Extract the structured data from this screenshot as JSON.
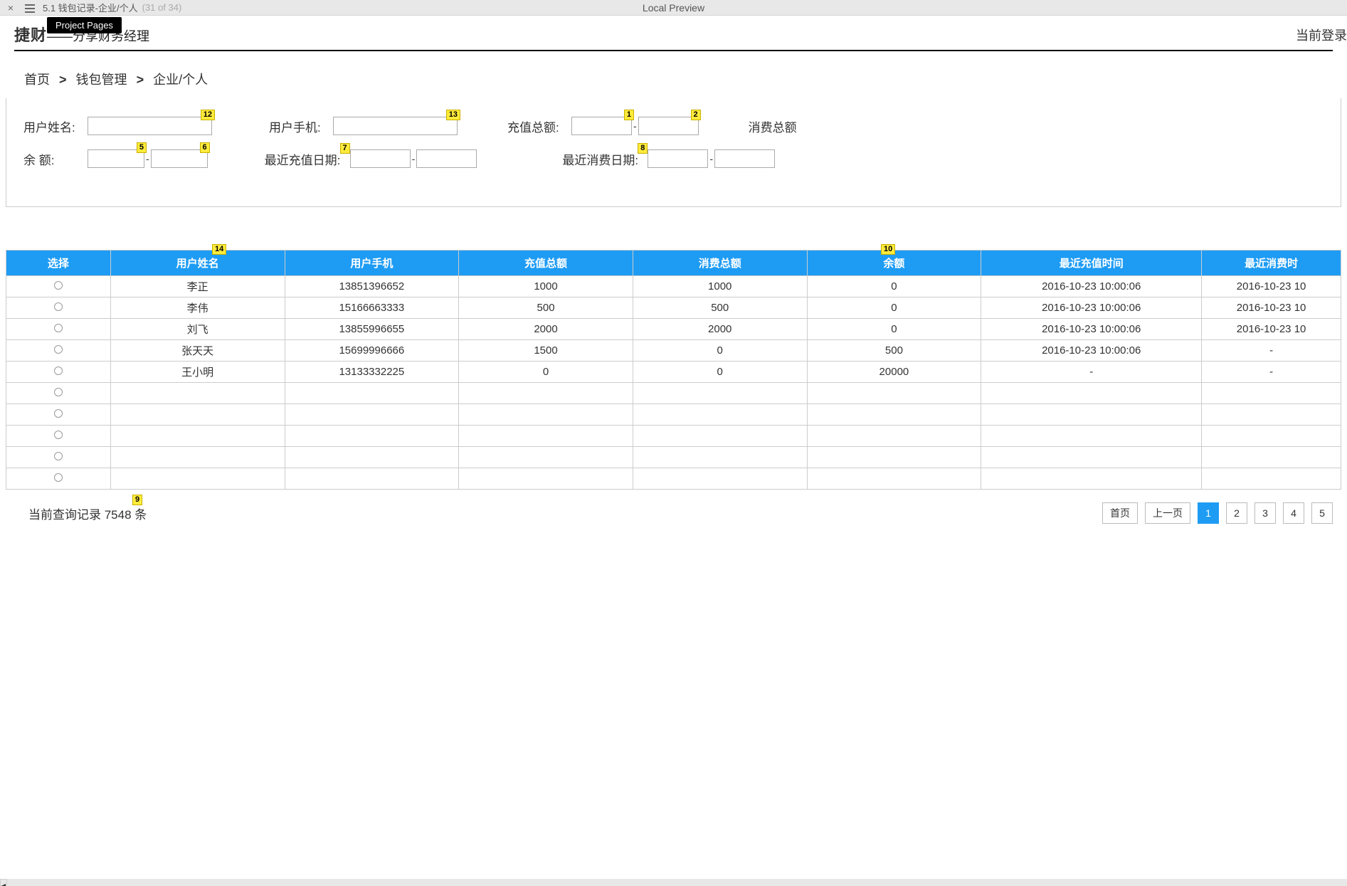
{
  "toolbar": {
    "title": "5.1 钱包记录-企业/个人",
    "count": "(31 of 34)",
    "preview": "Local Preview",
    "tooltip": "Project Pages"
  },
  "header": {
    "brand": "捷财",
    "brand_sep": "——",
    "brand_sub": "分享财务经理",
    "login": "当前登录"
  },
  "breadcrumb": {
    "items": [
      "首页",
      "钱包管理",
      "企业/个人"
    ],
    "sep": ">"
  },
  "filters": {
    "row1": {
      "name_label": "用户姓名:",
      "phone_label": "用户手机:",
      "recharge_label": "充值总额:",
      "consume_label": "消费总额"
    },
    "row2": {
      "balance_label": "余        额:",
      "recent_recharge_label": "最近充值日期:",
      "recent_consume_label": "最近消费日期:"
    }
  },
  "table": {
    "headers": [
      "选择",
      "用户姓名",
      "用户手机",
      "充值总额",
      "消费总额",
      "余额",
      "最近充值时间",
      "最近消费时"
    ],
    "rows": [
      {
        "name": "李正",
        "phone": "13851396652",
        "recharge": "1000",
        "consume": "1000",
        "balance": "0",
        "rtime": "2016-10-23 10:00:06",
        "ctime": "2016-10-23 10"
      },
      {
        "name": "李伟",
        "phone": "15166663333",
        "recharge": "500",
        "consume": "500",
        "balance": "0",
        "rtime": "2016-10-23 10:00:06",
        "ctime": "2016-10-23 10"
      },
      {
        "name": "刘飞",
        "phone": "13855996655",
        "recharge": "2000",
        "consume": "2000",
        "balance": "0",
        "rtime": "2016-10-23 10:00:06",
        "ctime": "2016-10-23 10"
      },
      {
        "name": "张天天",
        "phone": "15699996666",
        "recharge": "1500",
        "consume": "0",
        "balance": "500",
        "rtime": "2016-10-23 10:00:06",
        "ctime": "-"
      },
      {
        "name": "王小明",
        "phone": "13133332225",
        "recharge": "0",
        "consume": "0",
        "balance": "20000",
        "rtime": "-",
        "ctime": "-"
      },
      {
        "name": "",
        "phone": "",
        "recharge": "",
        "consume": "",
        "balance": "",
        "rtime": "",
        "ctime": ""
      },
      {
        "name": "",
        "phone": "",
        "recharge": "",
        "consume": "",
        "balance": "",
        "rtime": "",
        "ctime": ""
      },
      {
        "name": "",
        "phone": "",
        "recharge": "",
        "consume": "",
        "balance": "",
        "rtime": "",
        "ctime": ""
      },
      {
        "name": "",
        "phone": "",
        "recharge": "",
        "consume": "",
        "balance": "",
        "rtime": "",
        "ctime": ""
      },
      {
        "name": "",
        "phone": "",
        "recharge": "",
        "consume": "",
        "balance": "",
        "rtime": "",
        "ctime": ""
      }
    ]
  },
  "pager": {
    "count_text": "当前查询记录 7548 条",
    "first": "首页",
    "prev": "上一页",
    "pages": [
      "1",
      "2",
      "3",
      "4",
      "5"
    ],
    "active": "1"
  },
  "badges": {
    "b1": "1",
    "b2": "2",
    "b5": "5",
    "b6": "6",
    "b7": "7",
    "b8": "8",
    "b9": "9",
    "b10": "10",
    "b12": "12",
    "b13": "13",
    "b14": "14"
  }
}
